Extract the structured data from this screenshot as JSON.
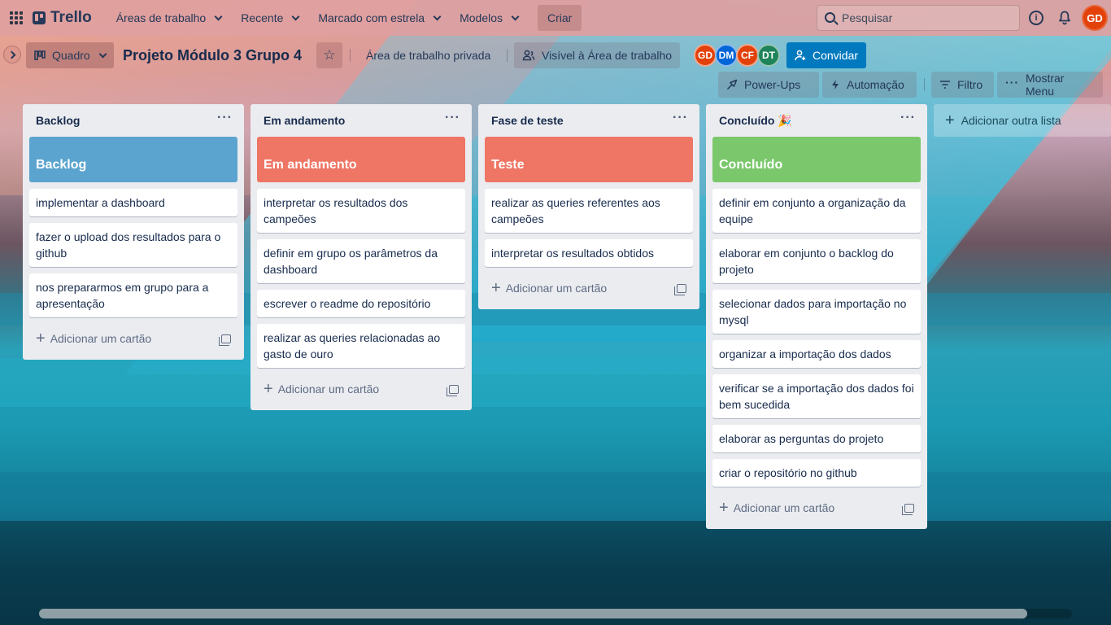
{
  "topnav": {
    "logo": "Trello",
    "menus": [
      "Áreas de trabalho",
      "Recente",
      "Marcado com estrela",
      "Modelos"
    ],
    "create": "Criar",
    "search_placeholder": "Pesquisar",
    "user_initials": "GD"
  },
  "board": {
    "view_label": "Quadro",
    "title": "Projeto Módulo 3 Grupo 4",
    "workspace": "Área de trabalho privada",
    "visibility": "Visível à Área de trabalho",
    "members": [
      {
        "initials": "GD",
        "color": "#e2420a"
      },
      {
        "initials": "DM",
        "color": "#0065d9"
      },
      {
        "initials": "CF",
        "color": "#e2420a"
      },
      {
        "initials": "DT",
        "color": "#1f845a"
      }
    ],
    "invite": "Convidar",
    "powerups": "Power-Ups",
    "automation": "Automação",
    "filter": "Filtro",
    "show_menu": "Mostrar Menu"
  },
  "lists": [
    {
      "title": "Backlog",
      "cover": "Backlog",
      "cover_color": "#5ba4cf",
      "cards": [
        "implementar a dashboard",
        "fazer o upload dos resultados para o github",
        "nos prepararmos em grupo para a apresentação"
      ],
      "add_card": "Adicionar um cartão"
    },
    {
      "title": "Em andamento",
      "cover": "Em andamento",
      "cover_color": "#ef7564",
      "cards": [
        "interpretar os resultados dos campeões",
        "definir em grupo os parâmetros da dashboard",
        "escrever o readme do repositório",
        "realizar as queries relacionadas ao gasto de ouro"
      ],
      "add_card": "Adicionar um cartão"
    },
    {
      "title": "Fase de teste",
      "cover": "Teste",
      "cover_color": "#ef7564",
      "cards": [
        "realizar as queries referentes aos campeões",
        "interpretar os resultados obtidos"
      ],
      "add_card": "Adicionar um cartão"
    },
    {
      "title": "Concluído 🎉",
      "cover": "Concluído",
      "cover_color": "#7bc86c",
      "cards": [
        "definir em conjunto a organização da equipe",
        "elaborar em conjunto o backlog do projeto",
        "selecionar dados para importação no mysql",
        "organizar a importação dos dados",
        "verificar se a importação dos dados foi bem sucedida",
        "elaborar as perguntas do projeto",
        "criar o repositório no github"
      ],
      "add_card": "Adicionar um cartão"
    }
  ],
  "add_list": "Adicionar outra lista"
}
